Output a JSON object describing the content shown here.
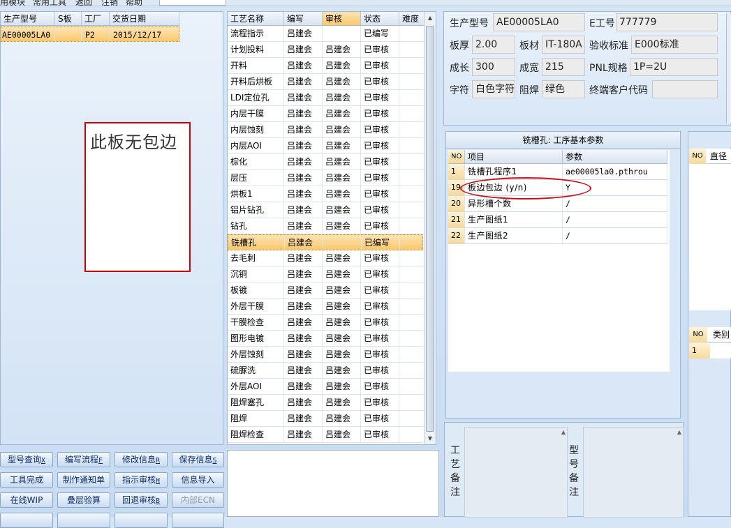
{
  "menu": {
    "items": [
      "用模块",
      "常用工具",
      "返回",
      "注销",
      "帮助"
    ]
  },
  "order_grid": {
    "headers": [
      "生产型号",
      "S板",
      "工厂",
      "交货日期"
    ],
    "rows": [
      {
        "model": "AE00005LA0",
        "s_board": "",
        "factory": "P2",
        "delivery_date": "2015/12/17"
      }
    ],
    "notice": "此板无包边"
  },
  "process_grid": {
    "headers": [
      "工艺名称",
      "编写",
      "审核",
      "状态",
      "难度"
    ],
    "rows": [
      {
        "name": "流程指示",
        "author": "吕建会",
        "reviewer": "",
        "status": "已编写",
        "difficulty": ""
      },
      {
        "name": "计划投料",
        "author": "吕建会",
        "reviewer": "吕建会",
        "status": "已审核",
        "difficulty": ""
      },
      {
        "name": "开料",
        "author": "吕建会",
        "reviewer": "吕建会",
        "status": "已审核",
        "difficulty": ""
      },
      {
        "name": "开料后烘板",
        "author": "吕建会",
        "reviewer": "吕建会",
        "status": "已审核",
        "difficulty": ""
      },
      {
        "name": "LDI定位孔",
        "author": "吕建会",
        "reviewer": "吕建会",
        "status": "已审核",
        "difficulty": ""
      },
      {
        "name": "内层干膜",
        "author": "吕建会",
        "reviewer": "吕建会",
        "status": "已审核",
        "difficulty": ""
      },
      {
        "name": "内层蚀刻",
        "author": "吕建会",
        "reviewer": "吕建会",
        "status": "已审核",
        "difficulty": ""
      },
      {
        "name": "内层AOI",
        "author": "吕建会",
        "reviewer": "吕建会",
        "status": "已审核",
        "difficulty": ""
      },
      {
        "name": "棕化",
        "author": "吕建会",
        "reviewer": "吕建会",
        "status": "已审核",
        "difficulty": ""
      },
      {
        "name": "层压",
        "author": "吕建会",
        "reviewer": "吕建会",
        "status": "已审核",
        "difficulty": ""
      },
      {
        "name": "烘板1",
        "author": "吕建会",
        "reviewer": "吕建会",
        "status": "已审核",
        "difficulty": ""
      },
      {
        "name": "铝片钻孔",
        "author": "吕建会",
        "reviewer": "吕建会",
        "status": "已审核",
        "difficulty": ""
      },
      {
        "name": "钻孔",
        "author": "吕建会",
        "reviewer": "吕建会",
        "status": "已审核",
        "difficulty": ""
      },
      {
        "name": "铣槽孔",
        "author": "吕建会",
        "reviewer": "",
        "status": "已编写",
        "difficulty": ""
      },
      {
        "name": "去毛刺",
        "author": "吕建会",
        "reviewer": "吕建会",
        "status": "已审核",
        "difficulty": ""
      },
      {
        "name": "沉铜",
        "author": "吕建会",
        "reviewer": "吕建会",
        "status": "已审核",
        "difficulty": ""
      },
      {
        "name": "板镀",
        "author": "吕建会",
        "reviewer": "吕建会",
        "status": "已审核",
        "difficulty": ""
      },
      {
        "name": "外层干膜",
        "author": "吕建会",
        "reviewer": "吕建会",
        "status": "已审核",
        "difficulty": ""
      },
      {
        "name": "干膜检查",
        "author": "吕建会",
        "reviewer": "吕建会",
        "status": "已审核",
        "difficulty": ""
      },
      {
        "name": "图形电镀",
        "author": "吕建会",
        "reviewer": "吕建会",
        "status": "已审核",
        "difficulty": ""
      },
      {
        "name": "外层蚀刻",
        "author": "吕建会",
        "reviewer": "吕建会",
        "status": "已审核",
        "difficulty": ""
      },
      {
        "name": "硫脲洗",
        "author": "吕建会",
        "reviewer": "吕建会",
        "status": "已审核",
        "difficulty": ""
      },
      {
        "name": "外层AOI",
        "author": "吕建会",
        "reviewer": "吕建会",
        "status": "已审核",
        "difficulty": ""
      },
      {
        "name": "阻焊塞孔",
        "author": "吕建会",
        "reviewer": "吕建会",
        "status": "已审核",
        "difficulty": ""
      },
      {
        "name": "阻焊",
        "author": "吕建会",
        "reviewer": "吕建会",
        "status": "已审核",
        "difficulty": ""
      },
      {
        "name": "阻焊检查",
        "author": "吕建会",
        "reviewer": "吕建会",
        "status": "已审核",
        "difficulty": ""
      }
    ]
  },
  "buttons": {
    "query_model": {
      "label": "型号查询",
      "hotkey": "X"
    },
    "write_flow": {
      "label": "编写流程",
      "hotkey": "F"
    },
    "modify_info": {
      "label": "修改信息",
      "hotkey": "R"
    },
    "save_info": {
      "label": "保存信息",
      "hotkey": "S"
    },
    "tool_done": "工具完成",
    "make_notice": "制作通知单",
    "instruction_review": {
      "label": "指示审核",
      "hotkey": "H"
    },
    "import_info": "信息导入",
    "online_wip": "在线WIP",
    "stack_verify": "叠层验算",
    "rollback_review": {
      "label": "回退审核",
      "hotkey": "B"
    },
    "internal_ecn": "内部ECN"
  },
  "info": {
    "model_label": "生产型号",
    "model_value": "AE00005LA0",
    "e_no_label": "E工号",
    "e_no_value": "777779",
    "thickness_label": "板厚",
    "thickness_value": "2.00",
    "material_label": "板材",
    "material_value": "IT-180A",
    "standard_label": "验收标准",
    "standard_value": "E000标准",
    "length_label": "成长",
    "length_value": "300",
    "width_label": "成宽",
    "width_value": "215",
    "pnl_label": "PNL规格",
    "pnl_value": "1P=2U",
    "char_label": "字符",
    "char_value": "白色字符",
    "mask_label": "阻焊",
    "mask_value": "绿色",
    "customer_label": "终端客户代码",
    "customer_value": ""
  },
  "params": {
    "title": "铣槽孔: 工序基本参数",
    "headers": [
      "NO",
      "项目",
      "参数"
    ],
    "rows": [
      {
        "no": "1",
        "item": "铣槽孔程序1",
        "value": "ae00005la0.pthrou"
      },
      {
        "no": "19",
        "item": "板边包边 (y/n)",
        "value": "Y"
      },
      {
        "no": "20",
        "item": "异形槽个数",
        "value": "/"
      },
      {
        "no": "21",
        "item": "生产图纸1",
        "value": "/"
      },
      {
        "no": "22",
        "item": "生产图纸2",
        "value": "/"
      }
    ]
  },
  "far_right": {
    "top_headers": [
      "NO",
      "直径"
    ],
    "bottom_headers": [
      "NO",
      "类别"
    ],
    "bottom_rows": [
      {
        "no": "1"
      }
    ]
  },
  "remarks": {
    "process_label": "工艺备注",
    "model_label": "型号备注"
  },
  "colors": {
    "selection": "#fbc86e",
    "highlight": "#c8101a",
    "notice_border": "#d00000"
  }
}
